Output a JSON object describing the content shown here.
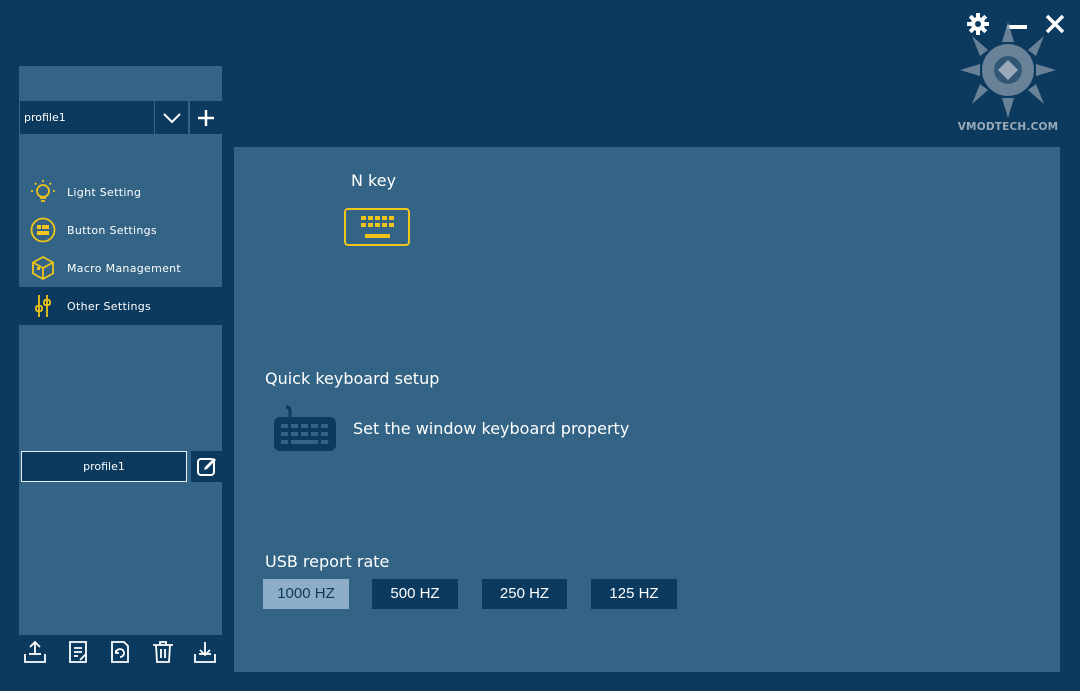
{
  "window": {
    "controls": [
      "gear-icon",
      "minimize-icon",
      "close-icon"
    ],
    "watermark": "VMODTECH.COM"
  },
  "sidebar": {
    "profile_select_value": "profile1",
    "items": [
      {
        "label": "Light Setting",
        "icon": "lightbulb-icon"
      },
      {
        "label": "Button Settings",
        "icon": "button-settings-icon"
      },
      {
        "label": "Macro Management",
        "icon": "macro-cube-icon"
      },
      {
        "label": "Other Settings",
        "icon": "sliders-icon",
        "active": true
      }
    ],
    "profile_name": "profile1",
    "toolbar_icons": [
      "import-icon",
      "export-document-icon",
      "reset-icon",
      "trash-icon",
      "save-icon"
    ]
  },
  "main": {
    "nkey_title": "N key",
    "quick_title": "Quick keyboard setup",
    "keyboard_property_label": "Set the window keyboard property",
    "usb_title": "USB report rate",
    "rates": [
      "1000 HZ",
      "500 HZ",
      "250 HZ",
      "125 HZ"
    ],
    "selected_rate": "1000 HZ"
  },
  "colors": {
    "background": "#0b3a5e",
    "panel": "#336485",
    "accent_yellow": "#f0c419",
    "selected_rate": "#8eadc6"
  }
}
